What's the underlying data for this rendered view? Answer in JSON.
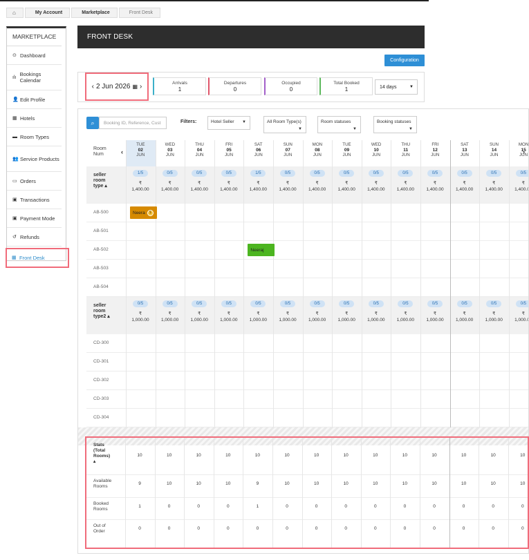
{
  "breadcrumb": {
    "home_icon": "home-icon",
    "items": [
      "My Account",
      "Marketplace",
      "Front Desk"
    ]
  },
  "sidebar": {
    "title": "MARKETPLACE",
    "items": [
      {
        "label": "Dashboard",
        "icon": "dashboard-icon",
        "glyph": "⊙"
      },
      {
        "label": "Bookings Calendar",
        "icon": "bar-chart-icon",
        "glyph": "ılı"
      },
      {
        "label": "Edit Profile",
        "icon": "user-icon",
        "glyph": "👤"
      },
      {
        "label": "Hotels",
        "icon": "building-icon",
        "glyph": "▦"
      },
      {
        "label": "Room Types",
        "icon": "bed-icon",
        "glyph": "▬"
      },
      {
        "label": "Service Products",
        "icon": "users-icon",
        "glyph": "👥"
      },
      {
        "label": "Orders",
        "icon": "credit-card-icon",
        "glyph": "▭"
      },
      {
        "label": "Transactions",
        "icon": "money-icon",
        "glyph": "▣"
      },
      {
        "label": "Payment Mode",
        "icon": "money-icon",
        "glyph": "▣"
      },
      {
        "label": "Refunds",
        "icon": "undo-icon",
        "glyph": "↺"
      },
      {
        "label": "Front Desk",
        "icon": "calendar-icon",
        "glyph": "▦"
      }
    ]
  },
  "header": {
    "title": "FRONT DESK",
    "config_label": "Configuration"
  },
  "toolbar": {
    "date": "2 Jun 2026",
    "cards": [
      {
        "label": "Arrivals",
        "value": "1",
        "color": "#3bb0c9"
      },
      {
        "label": "Departures",
        "value": "0",
        "color": "#e0556a"
      },
      {
        "label": "Occupied",
        "value": "0",
        "color": "#a25fc9"
      },
      {
        "label": "Total Booked",
        "value": "1",
        "color": "#5cb85c"
      }
    ],
    "days": "14 days"
  },
  "filters": {
    "search_placeholder": "Booking ID, Reference, Cust",
    "label": "Filters:",
    "hotel": "Hotel Seller",
    "room_types": "All Room Type(s)",
    "room_status": "Room statuses",
    "booking_status": "Booking statuses"
  },
  "grid": {
    "room_num_label": "Room Num",
    "days": [
      {
        "dow": "TUE",
        "d": "02",
        "m": "JUN",
        "today": true
      },
      {
        "dow": "WED",
        "d": "03",
        "m": "JUN"
      },
      {
        "dow": "THU",
        "d": "04",
        "m": "JUN"
      },
      {
        "dow": "FRI",
        "d": "05",
        "m": "JUN"
      },
      {
        "dow": "SAT",
        "d": "06",
        "m": "JUN"
      },
      {
        "dow": "SUN",
        "d": "07",
        "m": "JUN"
      },
      {
        "dow": "MON",
        "d": "08",
        "m": "JUN"
      },
      {
        "dow": "TUE",
        "d": "09",
        "m": "JUN"
      },
      {
        "dow": "WED",
        "d": "10",
        "m": "JUN"
      },
      {
        "dow": "THU",
        "d": "11",
        "m": "JUN"
      },
      {
        "dow": "FRI",
        "d": "12",
        "m": "JUN"
      },
      {
        "dow": "SAT",
        "d": "13",
        "m": "JUN"
      },
      {
        "dow": "SUN",
        "d": "14",
        "m": "JUN"
      },
      {
        "dow": "MON",
        "d": "15",
        "m": "JUN"
      }
    ],
    "room_types": [
      {
        "name_lines": [
          "seller",
          "room",
          "type"
        ],
        "avail": [
          "1/5",
          "0/5",
          "0/5",
          "0/5",
          "1/5",
          "0/5",
          "0/5",
          "0/5",
          "0/5",
          "0/5",
          "0/5",
          "0/5",
          "0/5",
          "0/5"
        ],
        "price": "1,400.00",
        "rooms": [
          "AB-500",
          "AB-501",
          "AB-502",
          "AB-503",
          "AB-504"
        ]
      },
      {
        "name_lines": [
          "seller",
          "room",
          "type2"
        ],
        "avail": [
          "0/5",
          "0/5",
          "0/5",
          "0/5",
          "0/5",
          "0/5",
          "0/5",
          "0/5",
          "0/5",
          "0/5",
          "0/5",
          "0/5",
          "0/5",
          "0/5"
        ],
        "price": "1,000.00",
        "rooms": [
          "CD-300",
          "CD-301",
          "CD-302",
          "CD-303",
          "CD-304"
        ]
      }
    ],
    "currency": "₹",
    "bookings": [
      {
        "guest": "Neera",
        "room": "AB-500",
        "coin": "$",
        "color": "#d68a00"
      },
      {
        "guest": "Neeraj",
        "room": "AB-502",
        "color": "#4cb520"
      }
    ]
  },
  "stats": {
    "title_lines": [
      "Stats",
      "(Total",
      "Rooms)"
    ],
    "rows": [
      {
        "label_lines": [
          "Available",
          "Rooms"
        ],
        "values": [
          "9",
          "10",
          "10",
          "10",
          "9",
          "10",
          "10",
          "10",
          "10",
          "10",
          "10",
          "10",
          "10",
          "10"
        ]
      },
      {
        "label_lines": [
          "Booked",
          "Rooms"
        ],
        "values": [
          "1",
          "0",
          "0",
          "0",
          "1",
          "0",
          "0",
          "0",
          "0",
          "0",
          "0",
          "0",
          "0",
          "0"
        ]
      },
      {
        "label_lines": [
          "Out of",
          "Order"
        ],
        "values": [
          "0",
          "0",
          "0",
          "0",
          "0",
          "0",
          "0",
          "0",
          "0",
          "0",
          "0",
          "0",
          "0",
          "0"
        ]
      }
    ],
    "totals": [
      "10",
      "10",
      "10",
      "10",
      "10",
      "10",
      "10",
      "10",
      "10",
      "10",
      "10",
      "10",
      "10",
      "10"
    ]
  }
}
